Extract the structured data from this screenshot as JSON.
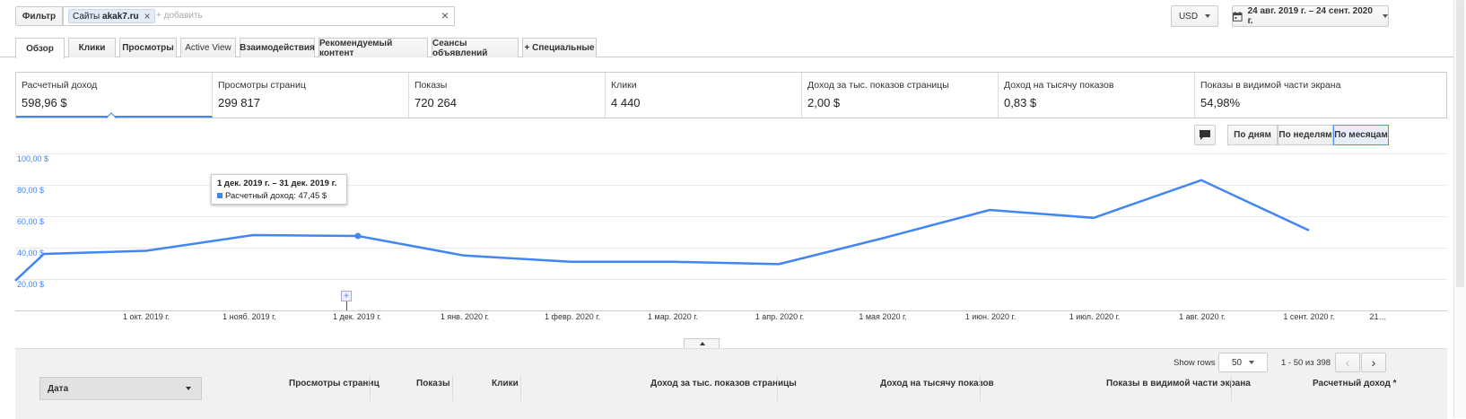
{
  "toolbar": {
    "filter_label": "Фильтр",
    "chip_prefix": "Сайты",
    "chip_value": "akak7.ru",
    "add_placeholder": "+ добавить",
    "currency": "USD",
    "date_range": "24 авг. 2019 г. – 24 сент. 2020 г."
  },
  "tabs": [
    {
      "label": "Обзор",
      "active": true
    },
    {
      "label": "Клики"
    },
    {
      "label": "Просмотры"
    },
    {
      "label": "Active View"
    },
    {
      "label": "Взаимодействия"
    },
    {
      "label": "Рекомендуемый контент"
    },
    {
      "label": "Сеансы объявлений"
    },
    {
      "label": "+  Специальные"
    }
  ],
  "metrics": [
    {
      "label": "Расчетный доход",
      "value": "598,96 $"
    },
    {
      "label": "Просмотры страниц",
      "value": "299 817"
    },
    {
      "label": "Показы",
      "value": "720 264"
    },
    {
      "label": "Клики",
      "value": "4 440"
    },
    {
      "label": "Доход за тыс. показов страницы",
      "value": "2,00 $"
    },
    {
      "label": "Доход на тысячу показов",
      "value": "0,83 $"
    },
    {
      "label": "Показы в видимой части экрана",
      "value": "54,98%"
    }
  ],
  "period_buttons": {
    "day": "По дням",
    "week": "По неделям",
    "month": "По месяцам",
    "active": "month"
  },
  "tooltip": {
    "title": "1 дек. 2019 г. – 31 дек. 2019 г.",
    "series_label": "Расчетный доход: 47,45 $"
  },
  "chart_data": {
    "type": "line",
    "y_tick_labels": [
      "100,00 $",
      "80,00 $",
      "60,00 $",
      "40,00 $",
      "20,00 $"
    ],
    "ylim": [
      0,
      100
    ],
    "x_tick_labels": [
      "1 окт. 2019 г.",
      "1 нояб. 2019 г.",
      "1 дек. 2019 г.",
      "1 янв. 2020 г.",
      "1 февр. 2020 г.",
      "1 мар. 2020 г.",
      "1 апр. 2020 г.",
      "1 мая 2020 г.",
      "1 июн. 2020 г.",
      "1 июл. 2020 г.",
      "1 авг. 2020 г.",
      "1 сент. 2020 г.",
      "21…"
    ],
    "color": "#4285f4",
    "series": [
      {
        "x": [
          "24.08.2019",
          "01.09.2019",
          "01.10.2019",
          "01.11.2019",
          "01.12.2019",
          "01.01.2020",
          "01.02.2020",
          "01.03.2020",
          "01.04.2020",
          "01.05.2020",
          "01.06.2020",
          "01.07.2020",
          "01.08.2020",
          "01.09.2020"
        ],
        "values": [
          19,
          36,
          38,
          48,
          47.45,
          35,
          31,
          31,
          29.5,
          46,
          64,
          59,
          83,
          51
        ]
      }
    ],
    "highlighted_index": 4
  },
  "table": {
    "show_rows_label": "Show rows",
    "rows_value": "50",
    "pagination": "1 - 50 из 398",
    "columns": [
      "Дата",
      "Просмотры страниц",
      "Показы",
      "Клики",
      "Доход за тыс. показов страницы",
      "Доход на тысячу показов",
      "Показы в видимой части экрана",
      "Расчетный доход *"
    ]
  }
}
